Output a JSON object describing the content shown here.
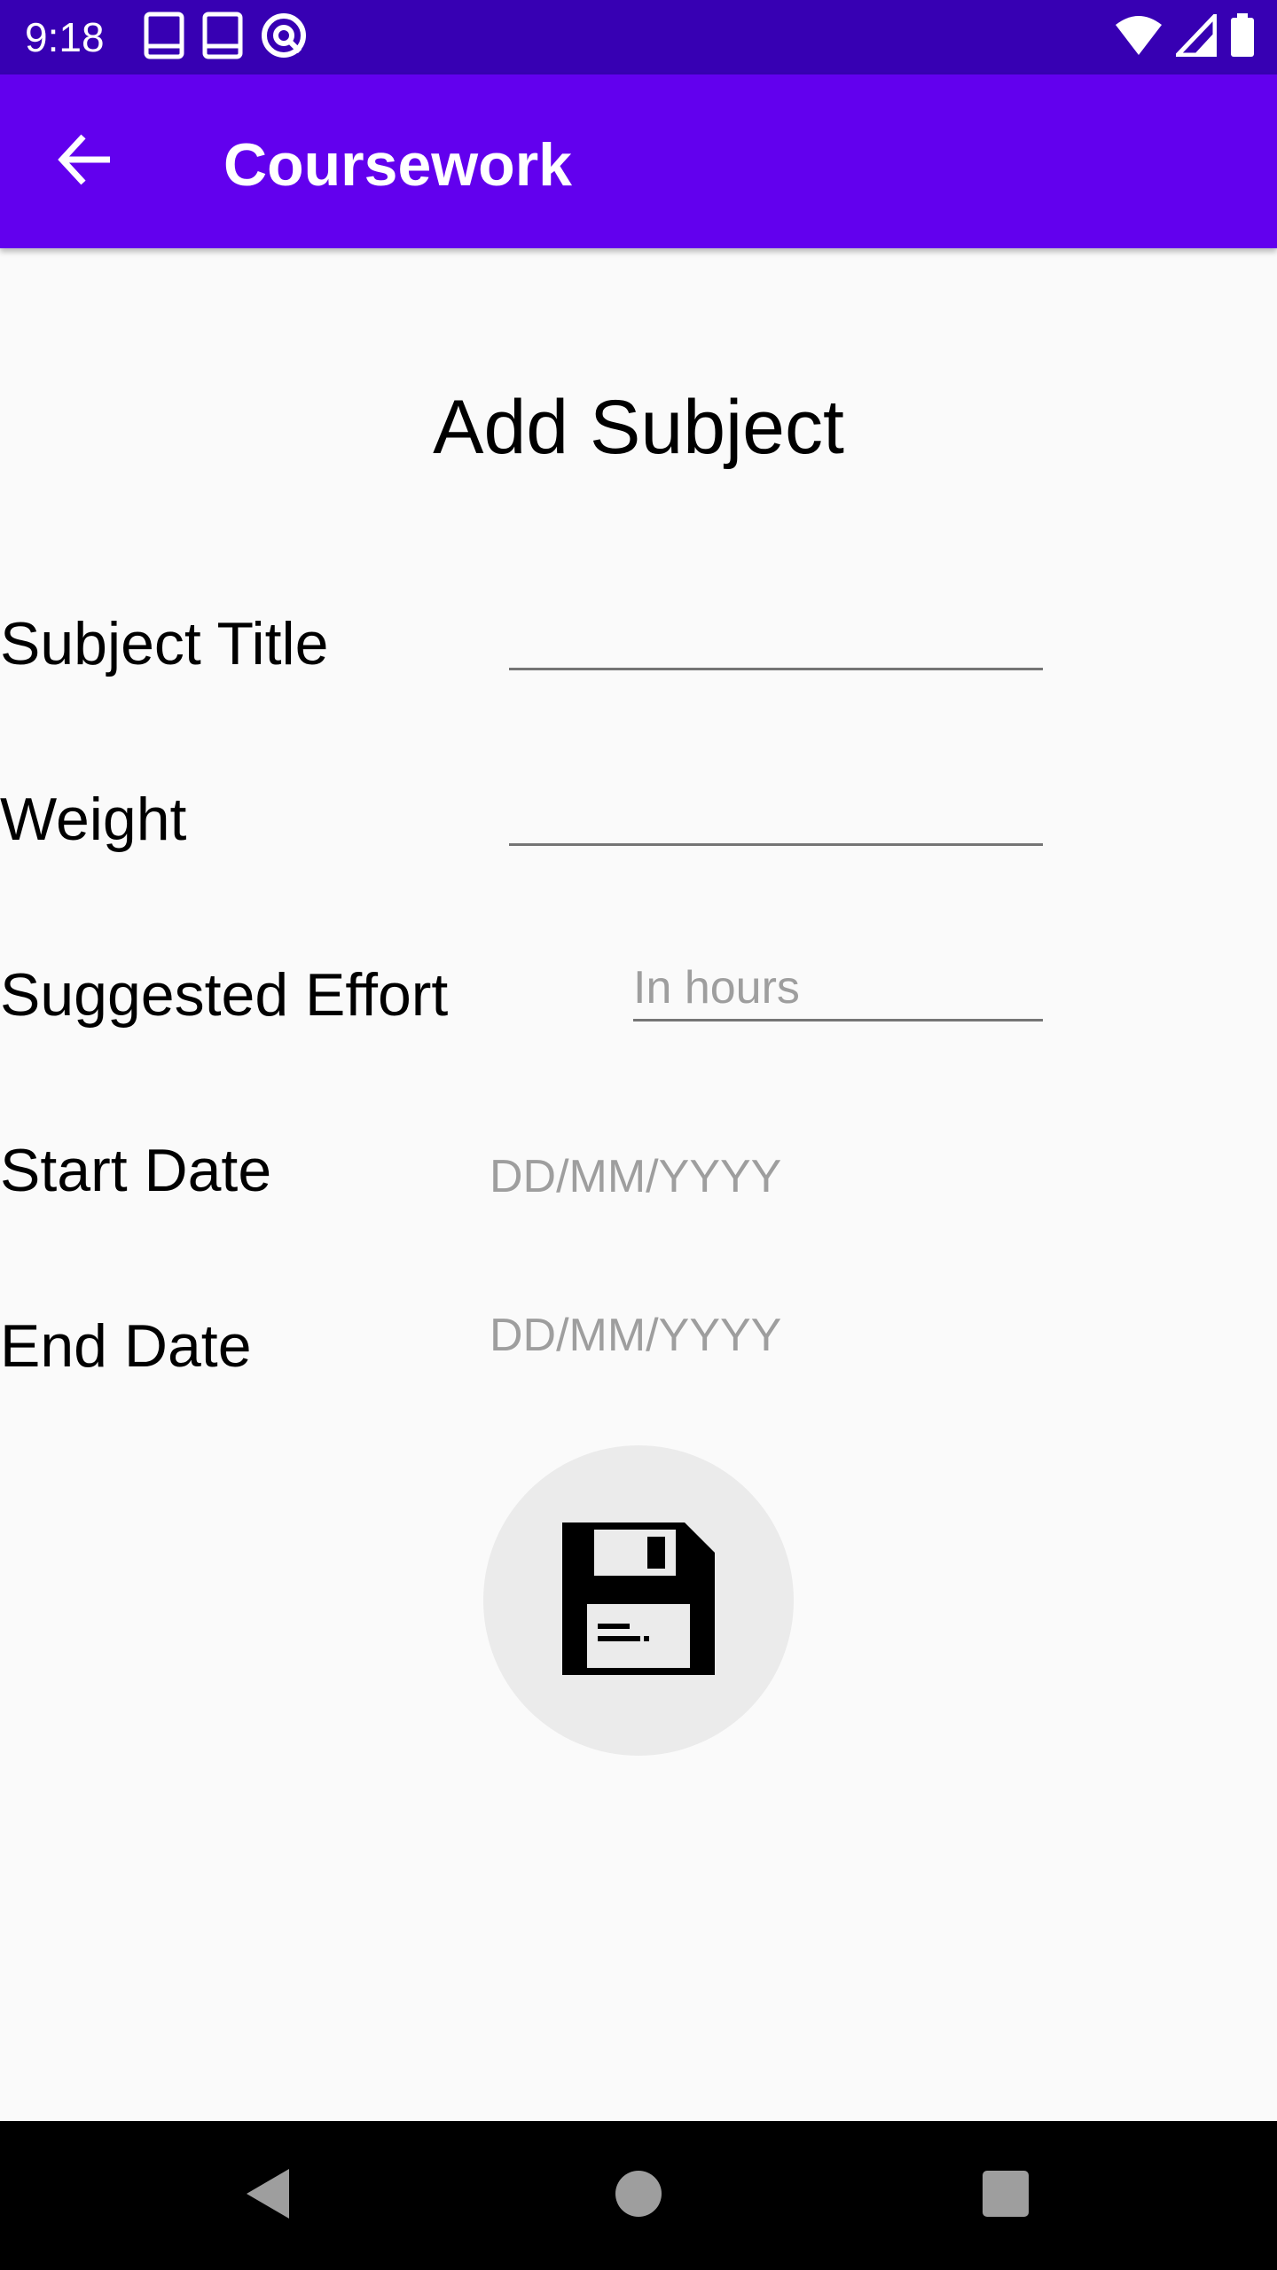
{
  "status_bar": {
    "time": "9:18",
    "left_icons": [
      "book-icon",
      "book-icon",
      "at-sign-icon"
    ],
    "right_icons": [
      "wifi-icon",
      "cellular-signal-icon",
      "battery-icon"
    ]
  },
  "app_bar": {
    "title": "Coursework",
    "back_icon": "arrow-left-icon"
  },
  "form": {
    "heading": "Add Subject",
    "subject_title": {
      "label": "Subject Title",
      "value": "",
      "placeholder": ""
    },
    "weight": {
      "label": "Weight",
      "value": "",
      "placeholder": ""
    },
    "suggested_effort": {
      "label": "Suggested Effort",
      "value": "",
      "placeholder": "In hours"
    },
    "start_date": {
      "label": "Start Date",
      "placeholder": "DD/MM/YYYY"
    },
    "end_date": {
      "label": "End Date",
      "placeholder": "DD/MM/YYYY"
    },
    "save_icon": "floppy-disk-icon"
  },
  "nav_bar": {
    "icons": [
      "back-triangle-icon",
      "home-circle-icon",
      "recents-square-icon"
    ]
  },
  "colors": {
    "status_bar": "#3700b3",
    "app_bar": "#6200ee",
    "background": "#fafafa",
    "fab_background": "#ebebeb",
    "hint_text": "#9e9e9e"
  }
}
